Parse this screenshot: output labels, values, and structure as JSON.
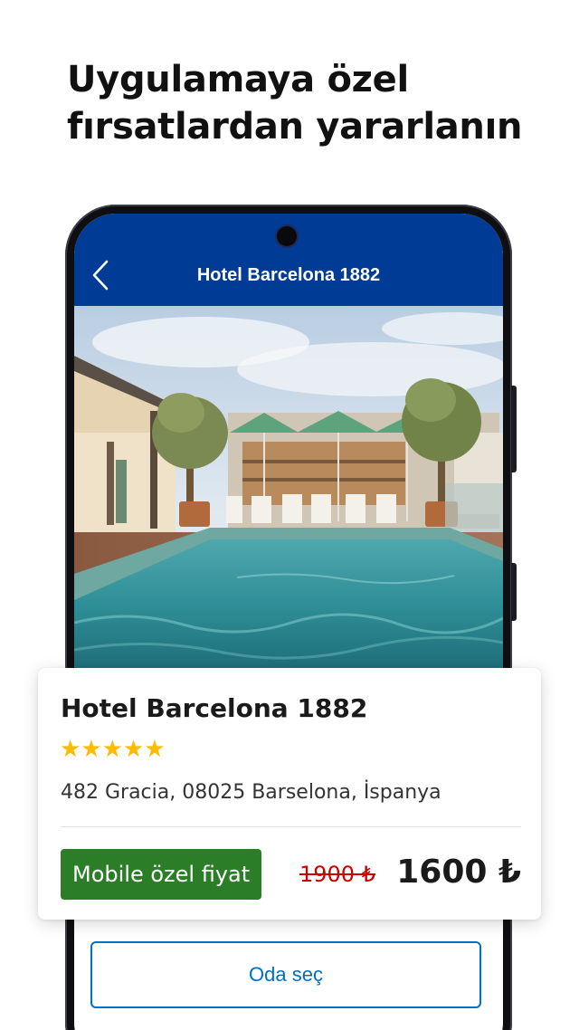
{
  "headline": {
    "line1": "Uygulamaya özel",
    "line2": "fırsatlardan yararlanın"
  },
  "app": {
    "title": "Hotel Barcelona 1882",
    "back_icon": "chevron-left-icon",
    "brand_color": "#003b95"
  },
  "hotel": {
    "name": "Hotel Barcelona 1882",
    "stars": "★★★★★",
    "star_rating": 5,
    "star_color": "#febb02",
    "address": "482 Gracia, 08025 Barselona, İspanya",
    "photo_subject": "rooftop pool with olive trees and striped parasols"
  },
  "pricing": {
    "badge_label": "Mobile özel fiyat",
    "badge_color": "#2b7d27",
    "old_price": "1900 ₺",
    "old_price_color": "#cc0000",
    "new_price": "1600 ₺"
  },
  "actions": {
    "choose_room_label": "Oda seç",
    "accent_color": "#0071c2"
  }
}
